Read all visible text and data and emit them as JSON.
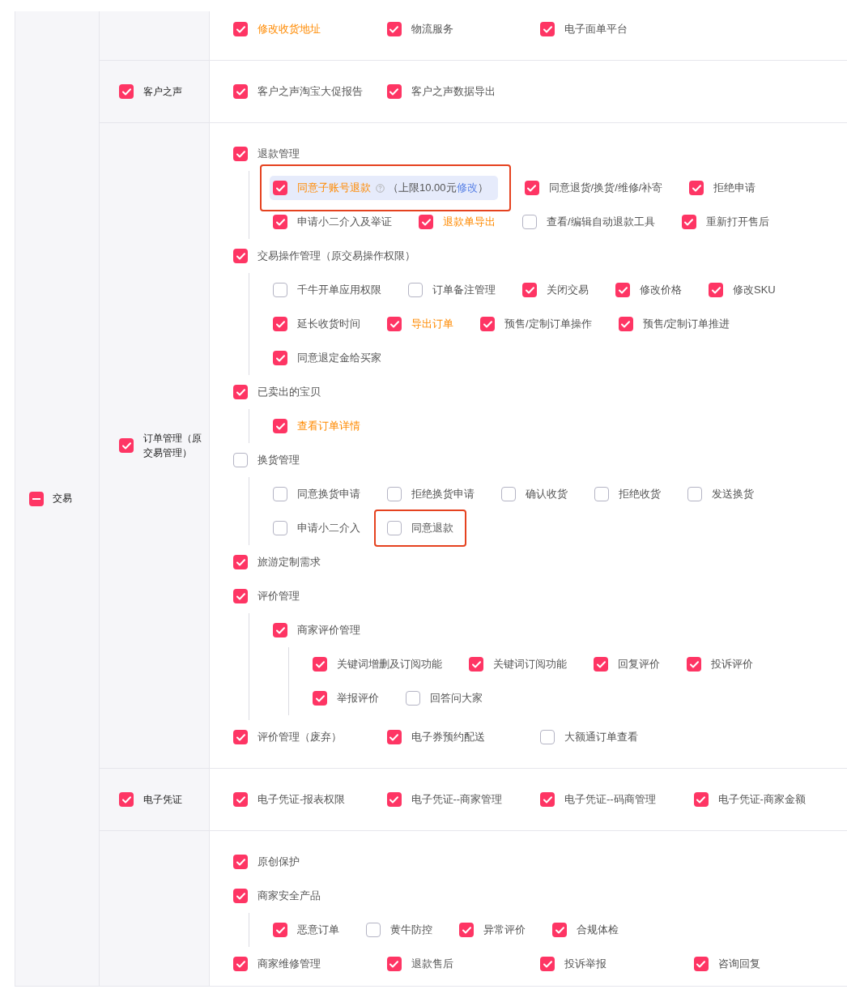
{
  "category": {
    "label": "交易",
    "indeterminate": true
  },
  "sections": [
    {
      "items": [
        {
          "label": "修改收货地址",
          "checked": true,
          "highlighted": true,
          "annotated": false
        },
        {
          "label": "物流服务",
          "checked": true,
          "highlighted": false,
          "annotated": false
        },
        {
          "label": "电子面单平台",
          "checked": true,
          "highlighted": false,
          "annotated": false
        }
      ]
    },
    {
      "group": {
        "label": "客户之声",
        "checked": true
      },
      "items": [
        {
          "label": "客户之声淘宝大促报告",
          "checked": true,
          "highlighted": false,
          "annotated": false
        },
        {
          "label": "客户之声数据导出",
          "checked": true,
          "highlighted": false,
          "annotated": false
        }
      ]
    },
    {
      "group": {
        "label": "订单管理（原交易管理）",
        "checked": true
      },
      "items": [
        {
          "label": "退款管理",
          "checked": true,
          "highlighted": false,
          "annotated": false,
          "children": [
            {
              "label": "同意子账号退款",
              "checked": true,
              "highlighted": true,
              "annotated": true,
              "note": "（上限10.00元",
              "note_link": "修改",
              "note_end": "）"
            },
            {
              "label": "同意退货/换货/维修/补寄",
              "checked": true,
              "highlighted": false,
              "annotated": false
            },
            {
              "label": "拒绝申请",
              "checked": true,
              "highlighted": false,
              "annotated": false
            },
            {
              "label": "申请小二介入及举证",
              "checked": true,
              "highlighted": false,
              "annotated": false
            },
            {
              "label": "退款单导出",
              "checked": true,
              "highlighted": true,
              "annotated": false
            },
            {
              "label": "查看/编辑自动退款工具",
              "checked": false,
              "highlighted": false,
              "annotated": false
            },
            {
              "label": "重新打开售后",
              "checked": true,
              "highlighted": false,
              "annotated": false
            }
          ]
        },
        {
          "label": "交易操作管理（原交易操作权限）",
          "checked": true,
          "highlighted": false,
          "annotated": false,
          "children": [
            {
              "label": "千牛开单应用权限",
              "checked": false,
              "highlighted": false,
              "annotated": false
            },
            {
              "label": "订单备注管理",
              "checked": false,
              "highlighted": false,
              "annotated": false
            },
            {
              "label": "关闭交易",
              "checked": true,
              "highlighted": false,
              "annotated": false
            },
            {
              "label": "修改价格",
              "checked": true,
              "highlighted": false,
              "annotated": false
            },
            {
              "label": "修改SKU",
              "checked": true,
              "highlighted": false,
              "annotated": false
            },
            {
              "label": "延长收货时间",
              "checked": true,
              "highlighted": false,
              "annotated": false
            },
            {
              "label": "导出订单",
              "checked": true,
              "highlighted": true,
              "annotated": false
            },
            {
              "label": "预售/定制订单操作",
              "checked": true,
              "highlighted": false,
              "annotated": false
            },
            {
              "label": "预售/定制订单推进",
              "checked": true,
              "highlighted": false,
              "annotated": false
            },
            {
              "label": "同意退定金给买家",
              "checked": true,
              "highlighted": false,
              "annotated": false
            }
          ]
        },
        {
          "label": "已卖出的宝贝",
          "checked": true,
          "highlighted": false,
          "annotated": false,
          "children": [
            {
              "label": "查看订单详情",
              "checked": true,
              "highlighted": true,
              "annotated": false
            }
          ]
        },
        {
          "label": "换货管理",
          "checked": false,
          "highlighted": false,
          "annotated": false,
          "children": [
            {
              "label": "同意换货申请",
              "checked": false,
              "highlighted": false,
              "annotated": false
            },
            {
              "label": "拒绝换货申请",
              "checked": false,
              "highlighted": false,
              "annotated": false
            },
            {
              "label": "确认收货",
              "checked": false,
              "highlighted": false,
              "annotated": false
            },
            {
              "label": "拒绝收货",
              "checked": false,
              "highlighted": false,
              "annotated": false
            },
            {
              "label": "发送换货",
              "checked": false,
              "highlighted": false,
              "annotated": false
            },
            {
              "label": "申请小二介入",
              "checked": false,
              "highlighted": false,
              "annotated": false
            },
            {
              "label": "同意退款",
              "checked": false,
              "highlighted": false,
              "annotated": true
            }
          ]
        },
        {
          "label": "旅游定制需求",
          "checked": true,
          "highlighted": false,
          "annotated": false
        },
        {
          "label": "评价管理",
          "checked": true,
          "highlighted": false,
          "annotated": false,
          "children": [
            {
              "label": "商家评价管理",
              "checked": true,
              "highlighted": false,
              "annotated": false,
              "children": [
                {
                  "label": "关键词增删及订阅功能",
                  "checked": true,
                  "highlighted": false,
                  "annotated": false
                },
                {
                  "label": "关键词订阅功能",
                  "checked": true,
                  "highlighted": false,
                  "annotated": false
                },
                {
                  "label": "回复评价",
                  "checked": true,
                  "highlighted": false,
                  "annotated": false
                },
                {
                  "label": "投诉评价",
                  "checked": true,
                  "highlighted": false,
                  "annotated": false
                },
                {
                  "label": "举报评价",
                  "checked": true,
                  "highlighted": false,
                  "annotated": false
                },
                {
                  "label": "回答问大家",
                  "checked": false,
                  "highlighted": false,
                  "annotated": false
                }
              ]
            }
          ]
        },
        {
          "label": "评价管理（废弃）",
          "checked": true,
          "highlighted": false,
          "annotated": false
        },
        {
          "label": "电子券预约配送",
          "checked": true,
          "highlighted": false,
          "annotated": false
        },
        {
          "label": "大额通订单查看",
          "checked": false,
          "highlighted": false,
          "annotated": false
        }
      ]
    },
    {
      "group": {
        "label": "电子凭证",
        "checked": true
      },
      "items": [
        {
          "label": "电子凭证-报表权限",
          "checked": true,
          "highlighted": false,
          "annotated": false
        },
        {
          "label": "电子凭证--商家管理",
          "checked": true,
          "highlighted": false,
          "annotated": false
        },
        {
          "label": "电子凭证--码商管理",
          "checked": true,
          "highlighted": false,
          "annotated": false
        },
        {
          "label": "电子凭证-商家金额",
          "checked": true,
          "highlighted": false,
          "annotated": false
        }
      ]
    },
    {
      "items": [
        {
          "label": "原创保护",
          "checked": true,
          "highlighted": false,
          "annotated": false
        },
        {
          "label": "商家安全产品",
          "checked": true,
          "highlighted": false,
          "annotated": false,
          "children": [
            {
              "label": "恶意订单",
              "checked": true,
              "highlighted": false,
              "annotated": false
            },
            {
              "label": "黄牛防控",
              "checked": false,
              "highlighted": false,
              "annotated": false
            },
            {
              "label": "异常评价",
              "checked": true,
              "highlighted": false,
              "annotated": false
            },
            {
              "label": "合规体检",
              "checked": true,
              "highlighted": false,
              "annotated": false
            }
          ]
        },
        {
          "label": "商家维修管理",
          "checked": true,
          "highlighted": false,
          "annotated": false
        },
        {
          "label": "退款售后",
          "checked": true,
          "highlighted": false,
          "annotated": false
        },
        {
          "label": "投诉举报",
          "checked": true,
          "highlighted": false,
          "annotated": false
        },
        {
          "label": "咨询回复",
          "checked": true,
          "highlighted": false,
          "annotated": false
        }
      ]
    }
  ]
}
